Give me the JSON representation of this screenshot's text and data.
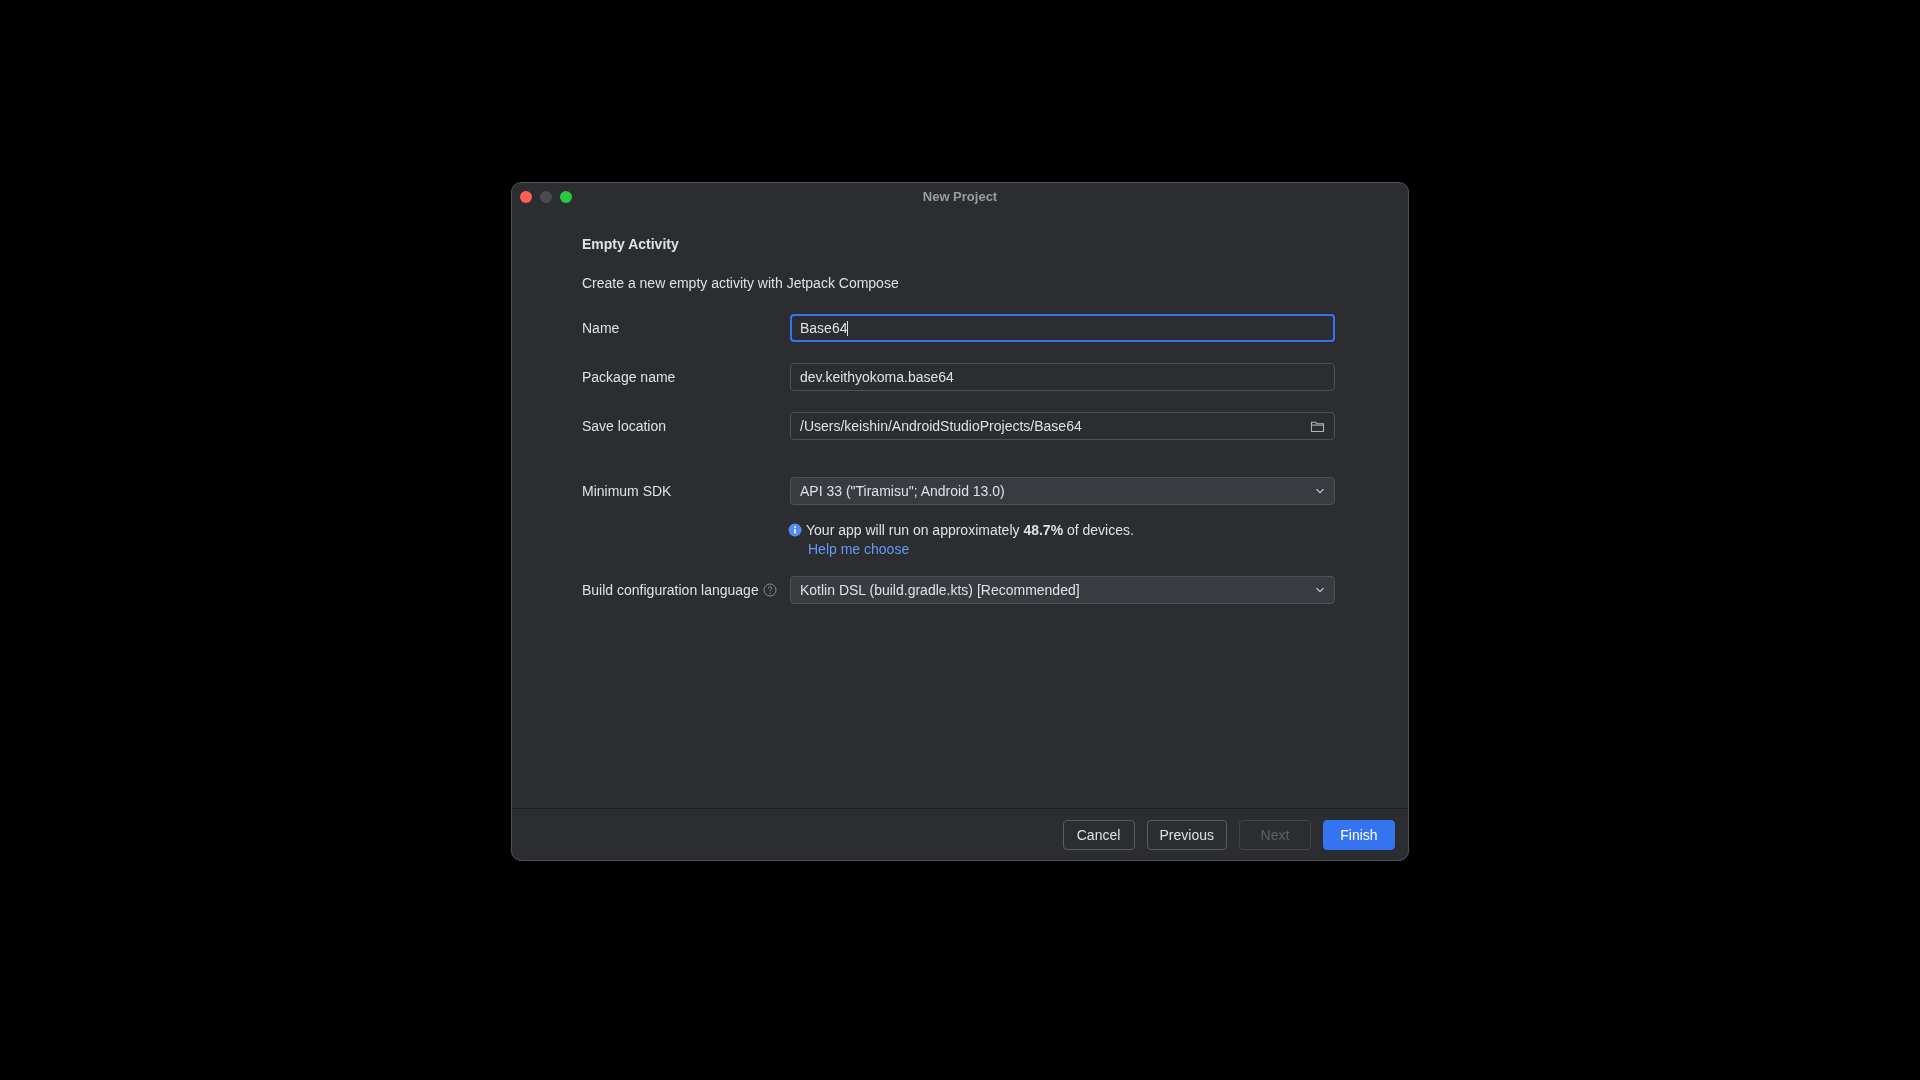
{
  "window": {
    "title": "New Project"
  },
  "heading": "Empty Activity",
  "description": "Create a new empty activity with Jetpack Compose",
  "fields": [
    {
      "kind": "text",
      "label": "Name",
      "value": "Base64",
      "focused": true
    },
    {
      "kind": "text",
      "label": "Package name",
      "value": "dev.keithyokoma.base64",
      "focused": false
    },
    {
      "kind": "path",
      "label": "Save location",
      "value": "/Users/keishin/AndroidStudioProjects/Base64",
      "focused": false
    },
    {
      "kind": "dropdown",
      "label": "Minimum SDK",
      "value": "API 33 (\"Tiramisu\"; Android 13.0)",
      "focused": false,
      "info": "Your app will run on approximately **48.7%** of devices.",
      "link": "Help me choose"
    },
    {
      "kind": "dropdown",
      "label": "Build configuration language",
      "value": "Kotlin DSL (build.gradle.kts) [Recommended]",
      "focused": false,
      "help": true
    }
  ],
  "buttons": [
    {
      "label": "Cancel",
      "kind": "normal",
      "disabled": false
    },
    {
      "label": "Previous",
      "kind": "normal",
      "disabled": false
    },
    {
      "label": "Next",
      "kind": "normal",
      "disabled": true
    },
    {
      "label": "Finish",
      "kind": "primary",
      "disabled": false
    }
  ]
}
